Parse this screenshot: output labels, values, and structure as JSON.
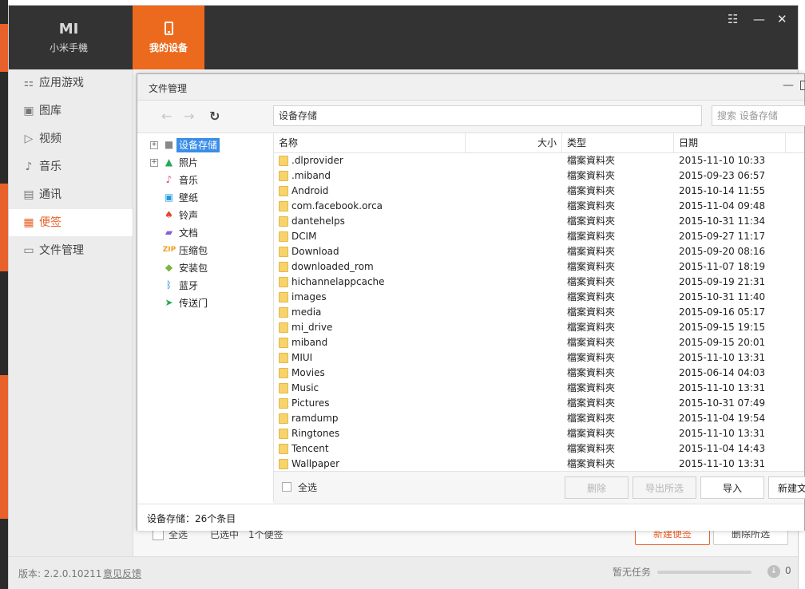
{
  "app": {
    "tabs": [
      {
        "glyph": "MI",
        "label": "小米手機"
      },
      {
        "label": "我的设备"
      }
    ],
    "window_controls": {
      "menu": "☷",
      "minimize": "—",
      "close": "✕"
    }
  },
  "sidebar": {
    "items": [
      {
        "icon": "apps-grid-icon",
        "glyph": "⚏",
        "label": "应用游戏"
      },
      {
        "icon": "picture-icon",
        "glyph": "▣",
        "label": "图库"
      },
      {
        "icon": "play-icon",
        "glyph": "▷",
        "label": "视频"
      },
      {
        "icon": "music-note-icon",
        "glyph": "♪",
        "label": "音乐"
      },
      {
        "icon": "contacts-icon",
        "glyph": "▤",
        "label": "通讯"
      },
      {
        "icon": "note-icon",
        "glyph": "▦",
        "label": "便签"
      },
      {
        "icon": "folder-icon",
        "glyph": "▭",
        "label": "文件管理"
      }
    ],
    "active_index": 5
  },
  "underlying": {
    "select_all": "全选",
    "selected_count": "已选中",
    "count": "1个便签",
    "new_note": "新建便签",
    "delete_selected": "删除所选"
  },
  "footer": {
    "version": "版本: 2.2.0.10211",
    "feedback": "意见反馈",
    "task": "暂无任务",
    "download_count": "0"
  },
  "dialog": {
    "title": "文件管理",
    "path": "设备存储",
    "search_placeholder": "搜索 设备存储",
    "tree": [
      {
        "icon": "storage-icon",
        "glyph": "■",
        "color": "#888888",
        "label": "设备存储",
        "expandable": true,
        "selected": true
      },
      {
        "icon": "photo-icon",
        "glyph": "▲",
        "color": "#27a85a",
        "label": "照片",
        "expandable": true
      },
      {
        "icon": "music-icon",
        "glyph": "♪",
        "color": "#e0457b",
        "label": "音乐"
      },
      {
        "icon": "wallpaper-icon",
        "glyph": "▣",
        "color": "#1e9be0",
        "label": "壁纸"
      },
      {
        "icon": "bell-icon",
        "glyph": "♠",
        "color": "#e8422f",
        "label": "铃声"
      },
      {
        "icon": "document-icon",
        "glyph": "▰",
        "color": "#8a5cd6",
        "label": "文档"
      },
      {
        "icon": "zip-icon",
        "glyph": "ZIP",
        "color": "#f0a020",
        "label": "压缩包"
      },
      {
        "icon": "android-icon",
        "glyph": "◆",
        "color": "#7cb342",
        "label": "安装包"
      },
      {
        "icon": "bluetooth-icon",
        "glyph": "ᛒ",
        "color": "#1c7fe0",
        "label": "蓝牙"
      },
      {
        "icon": "send-icon",
        "glyph": "➤",
        "color": "#2da84a",
        "label": "传送门"
      }
    ],
    "columns": {
      "name": "名称",
      "size": "大小",
      "type": "类型",
      "date": "日期"
    },
    "files": [
      {
        "name": ".dlprovider",
        "type": "檔案資料夾",
        "date": "2015-11-10 10:33"
      },
      {
        "name": ".miband",
        "type": "檔案資料夾",
        "date": "2015-09-23 06:57"
      },
      {
        "name": "Android",
        "type": "檔案資料夾",
        "date": "2015-10-14 11:55"
      },
      {
        "name": "com.facebook.orca",
        "type": "檔案資料夾",
        "date": "2015-11-04 09:48"
      },
      {
        "name": "dantehelps",
        "type": "檔案資料夾",
        "date": "2015-10-31 11:34"
      },
      {
        "name": "DCIM",
        "type": "檔案資料夾",
        "date": "2015-09-27 11:17"
      },
      {
        "name": "Download",
        "type": "檔案資料夾",
        "date": "2015-09-20 08:16"
      },
      {
        "name": "downloaded_rom",
        "type": "檔案資料夾",
        "date": "2015-11-07 18:19"
      },
      {
        "name": "hichannelappcache",
        "type": "檔案資料夾",
        "date": "2015-09-19 21:31"
      },
      {
        "name": "images",
        "type": "檔案資料夾",
        "date": "2015-10-31 11:40"
      },
      {
        "name": "media",
        "type": "檔案資料夾",
        "date": "2015-09-16 05:17"
      },
      {
        "name": "mi_drive",
        "type": "檔案資料夾",
        "date": "2015-09-15 19:15"
      },
      {
        "name": "miband",
        "type": "檔案資料夾",
        "date": "2015-09-15 20:01"
      },
      {
        "name": "MIUI",
        "type": "檔案資料夾",
        "date": "2015-11-10 13:31"
      },
      {
        "name": "Movies",
        "type": "檔案資料夾",
        "date": "2015-06-14 04:03"
      },
      {
        "name": "Music",
        "type": "檔案資料夾",
        "date": "2015-11-10 13:31"
      },
      {
        "name": "Pictures",
        "type": "檔案資料夾",
        "date": "2015-10-31 07:49"
      },
      {
        "name": "ramdump",
        "type": "檔案資料夾",
        "date": "2015-11-04 19:54"
      },
      {
        "name": "Ringtones",
        "type": "檔案資料夾",
        "date": "2015-11-10 13:31"
      },
      {
        "name": "Tencent",
        "type": "檔案資料夾",
        "date": "2015-11-04 14:43"
      },
      {
        "name": "Wallpaper",
        "type": "檔案資料夾",
        "date": "2015-11-10 13:31"
      }
    ],
    "footer": {
      "select_all": "全选",
      "delete": "删除",
      "export_selected": "导出所选",
      "import": "导入",
      "new_folder": "新建文"
    },
    "status": "设备存储：26个条目"
  },
  "colors": {
    "accent": "#ec6a1d",
    "topbar": "#333333",
    "selection": "#3a8ee6"
  }
}
